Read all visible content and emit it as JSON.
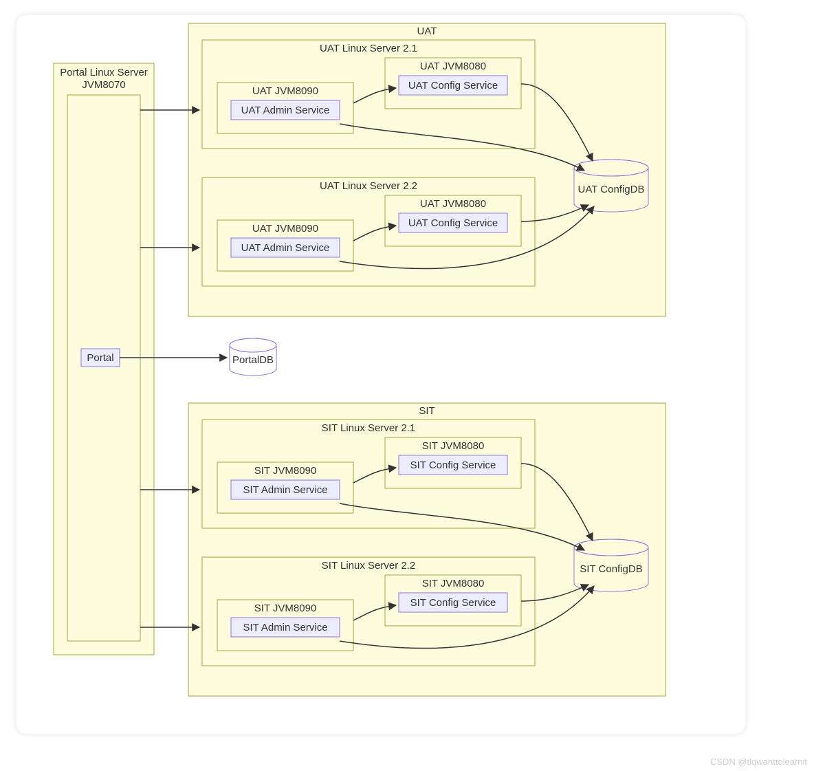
{
  "watermark": "CSDN @tlqwanttolearnit",
  "portalServer": {
    "title1": "Portal Linux Server",
    "title2": "JVM8070",
    "portal": "Portal"
  },
  "portalDB": "PortalDB",
  "uat": {
    "title": "UAT",
    "db": "UAT ConfigDB",
    "servers": [
      {
        "title": "UAT Linux Server 2.1",
        "jvm8090": {
          "title": "UAT JVM8090",
          "service": "UAT Admin Service"
        },
        "jvm8080": {
          "title": "UAT JVM8080",
          "service": "UAT Config Service"
        }
      },
      {
        "title": "UAT Linux Server 2.2",
        "jvm8090": {
          "title": "UAT JVM8090",
          "service": "UAT Admin Service"
        },
        "jvm8080": {
          "title": "UAT JVM8080",
          "service": "UAT Config Service"
        }
      }
    ]
  },
  "sit": {
    "title": "SIT",
    "db": "SIT ConfigDB",
    "servers": [
      {
        "title": "SIT Linux Server 2.1",
        "jvm8090": {
          "title": "SIT JVM8090",
          "service": "SIT Admin Service"
        },
        "jvm8080": {
          "title": "SIT JVM8080",
          "service": "SIT Config Service"
        }
      },
      {
        "title": "SIT Linux Server 2.2",
        "jvm8090": {
          "title": "SIT JVM8090",
          "service": "SIT Admin Service"
        },
        "jvm8080": {
          "title": "SIT JVM8080",
          "service": "SIT Config Service"
        }
      }
    ]
  }
}
